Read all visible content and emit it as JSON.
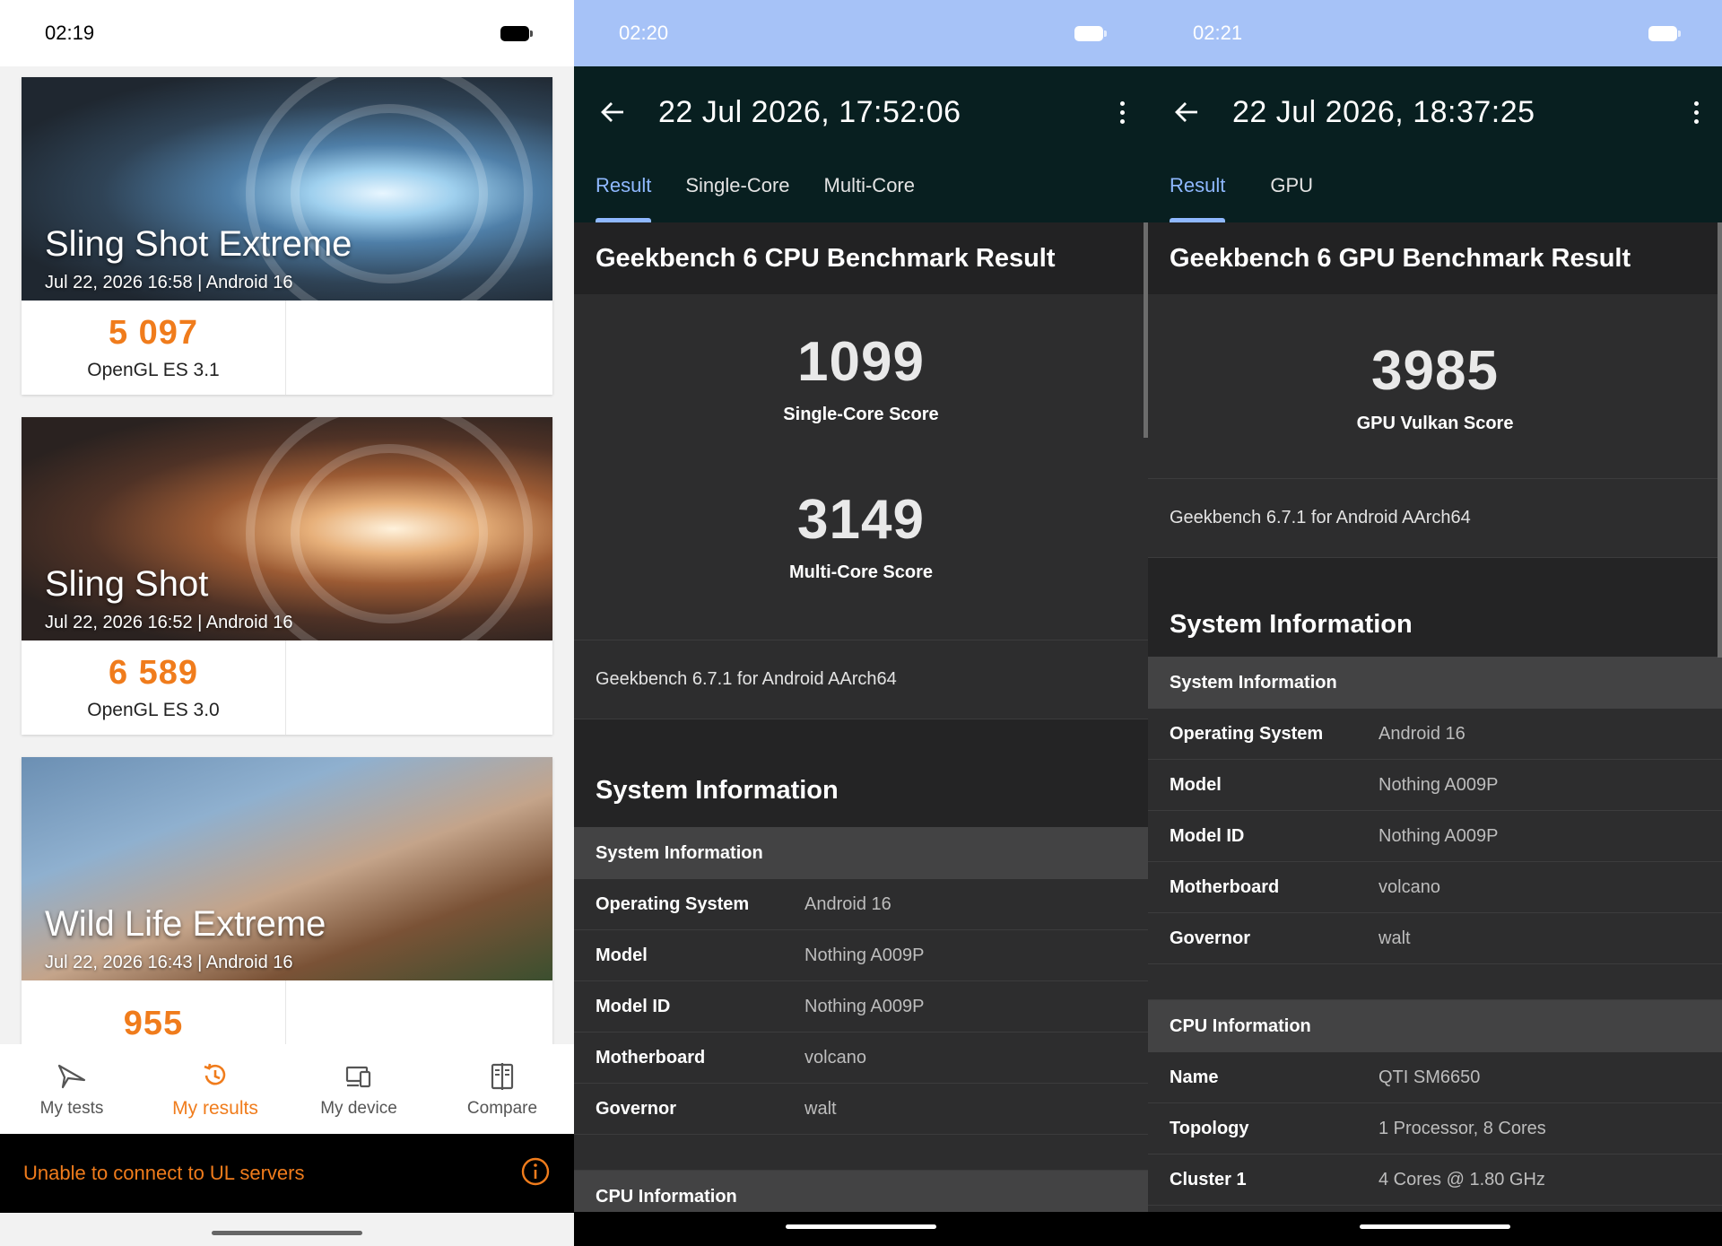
{
  "panel1": {
    "status_time": "02:19",
    "cards": [
      {
        "title": "Sling Shot Extreme",
        "meta": "Jul 22, 2026 16:58 | Android 16",
        "score": "5 097",
        "api": "OpenGL ES 3.1"
      },
      {
        "title": "Sling Shot",
        "meta": "Jul 22, 2026 16:52 | Android 16",
        "score": "6 589",
        "api": "OpenGL ES 3.0"
      },
      {
        "title": "Wild Life Extreme",
        "meta": "Jul 22, 2026 16:43 | Android 16",
        "score": "955",
        "api": ""
      }
    ],
    "nav": [
      {
        "label": "My tests",
        "icon": "plane-icon"
      },
      {
        "label": "My results",
        "icon": "history-icon"
      },
      {
        "label": "My device",
        "icon": "devices-icon"
      },
      {
        "label": "Compare",
        "icon": "compare-icon"
      }
    ],
    "connection_message": "Unable to connect to UL servers",
    "accent_color": "#f07c1c"
  },
  "panel2": {
    "status_time": "02:20",
    "title": "22 Jul 2026, 17:52:06",
    "tabs": [
      "Result",
      "Single-Core",
      "Multi-Core"
    ],
    "result_heading": "Geekbench 6 CPU Benchmark Result",
    "single_core_score": "1099",
    "single_core_label": "Single-Core Score",
    "multi_core_score": "3149",
    "multi_core_label": "Multi-Core Score",
    "version": "Geekbench 6.7.1 for Android AArch64",
    "system_info_title": "System Information",
    "system_info_subheading": "System Information",
    "system_info_rows": [
      {
        "key": "Operating System",
        "value": "Android 16"
      },
      {
        "key": "Model",
        "value": "Nothing A009P"
      },
      {
        "key": "Model ID",
        "value": "Nothing A009P"
      },
      {
        "key": "Motherboard",
        "value": "volcano"
      },
      {
        "key": "Governor",
        "value": "walt"
      }
    ],
    "cpu_info_subheading": "CPU Information"
  },
  "panel3": {
    "status_time": "02:21",
    "title": "22 Jul 2026, 18:37:25",
    "tabs": [
      "Result",
      "GPU"
    ],
    "result_heading": "Geekbench 6 GPU Benchmark Result",
    "gpu_score": "3985",
    "gpu_label": "GPU Vulkan Score",
    "version": "Geekbench 6.7.1 for Android AArch64",
    "system_info_title": "System Information",
    "system_info_subheading": "System Information",
    "system_info_rows": [
      {
        "key": "Operating System",
        "value": "Android 16"
      },
      {
        "key": "Model",
        "value": "Nothing A009P"
      },
      {
        "key": "Model ID",
        "value": "Nothing A009P"
      },
      {
        "key": "Motherboard",
        "value": "volcano"
      },
      {
        "key": "Governor",
        "value": "walt"
      }
    ],
    "cpu_info_subheading": "CPU Information",
    "cpu_info_rows": [
      {
        "key": "Name",
        "value": "QTI SM6650"
      },
      {
        "key": "Topology",
        "value": "1 Processor, 8 Cores"
      },
      {
        "key": "Cluster 1",
        "value": "4 Cores @ 1.80 GHz"
      }
    ],
    "tab_accent_color": "#8fb8ff"
  }
}
